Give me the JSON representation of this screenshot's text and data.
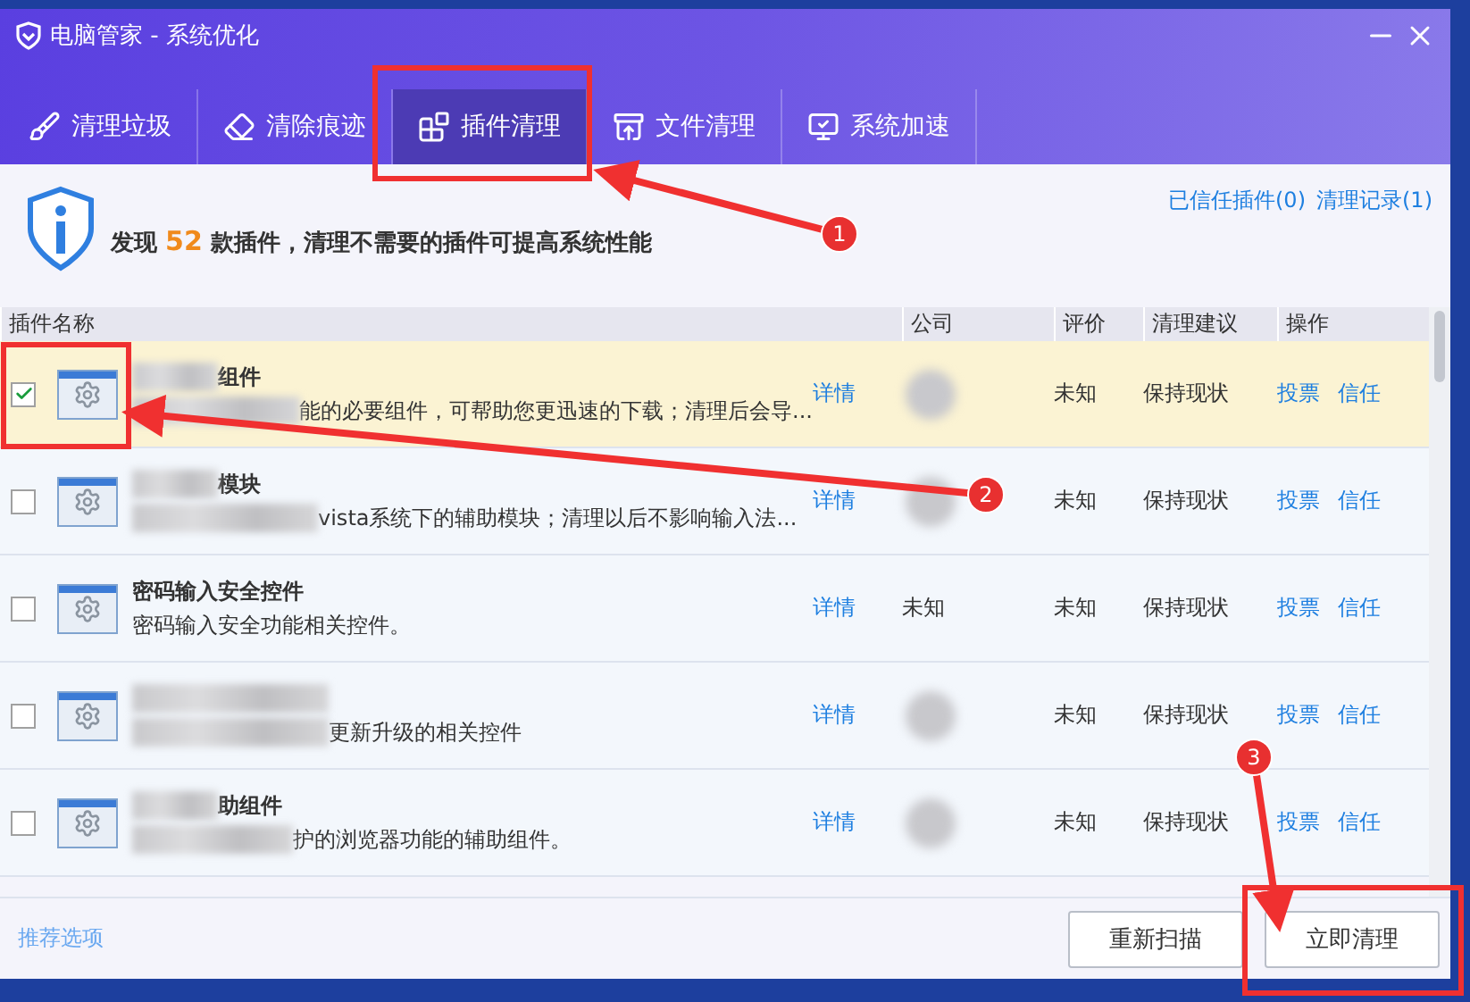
{
  "window": {
    "title": "电脑管家 - 系统优化"
  },
  "tabs": [
    {
      "label": "清理垃圾",
      "selected": false
    },
    {
      "label": "清除痕迹",
      "selected": false
    },
    {
      "label": "插件清理",
      "selected": true
    },
    {
      "label": "文件清理",
      "selected": false
    },
    {
      "label": "系统加速",
      "selected": false
    }
  ],
  "summary": {
    "text": "发现 **52** 款插件，清理不需要的插件可提高系统性能",
    "links": [
      "已信任插件(0)",
      "清理记录(1)"
    ]
  },
  "table": {
    "columns": [
      "插件名称",
      "公司",
      "评价",
      "清理建议",
      "操作"
    ],
    "rows": [
      {
        "checked": true,
        "selected": true,
        "name_redacted": true,
        "name": "组件",
        "description": "能的必要组件，可帮助您更迅速的下载；清理后会导...",
        "details": "详情",
        "company_redacted": true,
        "rating": "未知",
        "advice": "保持现状",
        "actions": [
          "投票",
          "信任"
        ]
      },
      {
        "checked": false,
        "selected": false,
        "name_redacted": true,
        "name": "模块",
        "description": "vista系统下的辅助模块；清理以后不影响输入法...",
        "details": "详情",
        "company_redacted": true,
        "rating": "未知",
        "advice": "保持现状",
        "actions": [
          "投票",
          "信任"
        ]
      },
      {
        "checked": false,
        "selected": false,
        "name_redacted": false,
        "name": "密码输入安全控件",
        "description": "密码输入安全功能相关控件。",
        "details": "详情",
        "company_redacted": false,
        "company": "未知",
        "rating": "未知",
        "advice": "保持现状",
        "actions": [
          "投票",
          "信任"
        ]
      },
      {
        "checked": false,
        "selected": false,
        "name_redacted": true,
        "description": "更新升级的相关控件",
        "details": "详情",
        "company_redacted": true,
        "rating": "未知",
        "advice": "保持现状",
        "actions": [
          "投票",
          "信任"
        ]
      },
      {
        "checked": false,
        "selected": false,
        "name_redacted": true,
        "name": "助组件",
        "description": "护的浏览器功能的辅助组件。",
        "details": "详情",
        "company_redacted": true,
        "rating": "未知",
        "advice": "保持现状",
        "actions": [
          "投票",
          "信任"
        ]
      }
    ]
  },
  "footer": {
    "link": "推荐选项",
    "buttons": [
      "重新扫描",
      "立即清理"
    ]
  },
  "annotations": [
    {
      "label": "1"
    },
    {
      "label": "2"
    },
    {
      "label": "3"
    }
  ]
}
